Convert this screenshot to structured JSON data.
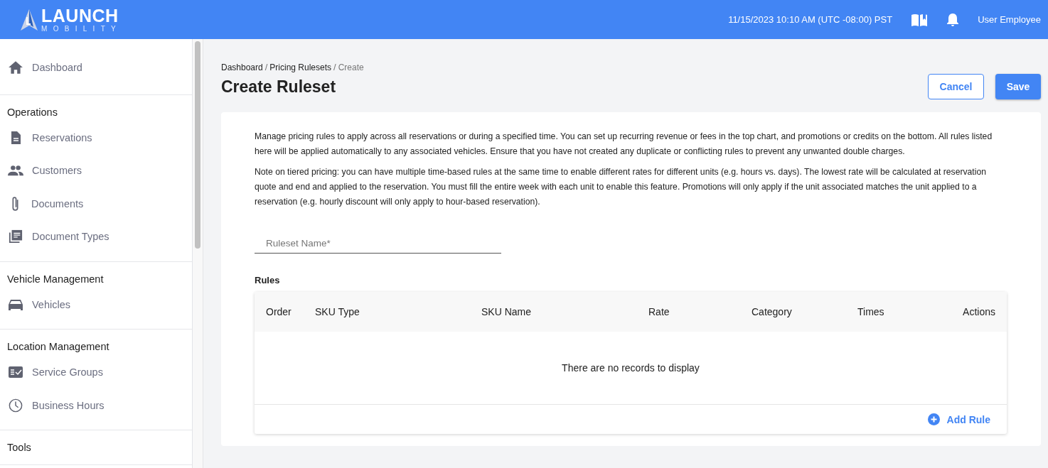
{
  "header": {
    "logo_title": "LAUNCH",
    "logo_subtitle": "MOBILITY",
    "datetime": "11/15/2023 10:10 AM (UTC -08:00) PST",
    "user": "User Employee"
  },
  "sidebar": {
    "groups": [
      {
        "items": [
          {
            "label": "Dashboard"
          }
        ]
      },
      {
        "heading": "Operations",
        "items": [
          {
            "label": "Reservations"
          },
          {
            "label": "Customers"
          },
          {
            "label": "Documents"
          },
          {
            "label": "Document Types"
          }
        ]
      },
      {
        "heading": "Vehicle Management",
        "items": [
          {
            "label": "Vehicles"
          }
        ]
      },
      {
        "heading": "Location Management",
        "items": [
          {
            "label": "Service Groups"
          },
          {
            "label": "Business Hours"
          }
        ]
      },
      {
        "heading": "Tools"
      }
    ]
  },
  "breadcrumb": [
    {
      "label": "Dashboard",
      "current": false
    },
    {
      "separator": "/",
      "label": "Pricing Rulesets",
      "current": false
    },
    {
      "separator": "/",
      "label": "Create",
      "current": true
    }
  ],
  "page_title": "Create Ruleset",
  "buttons": {
    "cancel": "Cancel",
    "save": "Save"
  },
  "description": [
    "Manage pricing rules to apply across all reservations or during a specified time. You can set up recurring revenue or fees in the top chart, and promotions or credits on the bottom. All rules listed here will be applied automatically to any associated vehicles. Ensure that you have not created any duplicate or conflicting rules to prevent any unwanted double charges.",
    "Note on tiered pricing: you can have multiple time-based rules at the same time to enable different rates for different units (e.g. hours vs. days). The lowest rate will be calculated at reservation quote and end and applied to the reservation. You must fill the entire week with each unit to enable this feature. Promotions will only apply if the unit associated matches the unit applied to a reservation (e.g. hourly discount will only apply to hour-based reservation)."
  ],
  "ruleset_name": {
    "placeholder": "Ruleset Name*"
  },
  "rules": {
    "title": "Rules",
    "columns": [
      "Order",
      "SKU Type",
      "SKU Name",
      "Rate",
      "Category",
      "Times",
      "Actions"
    ],
    "empty_message": "There are no records to display",
    "add_label": "Add Rule"
  }
}
